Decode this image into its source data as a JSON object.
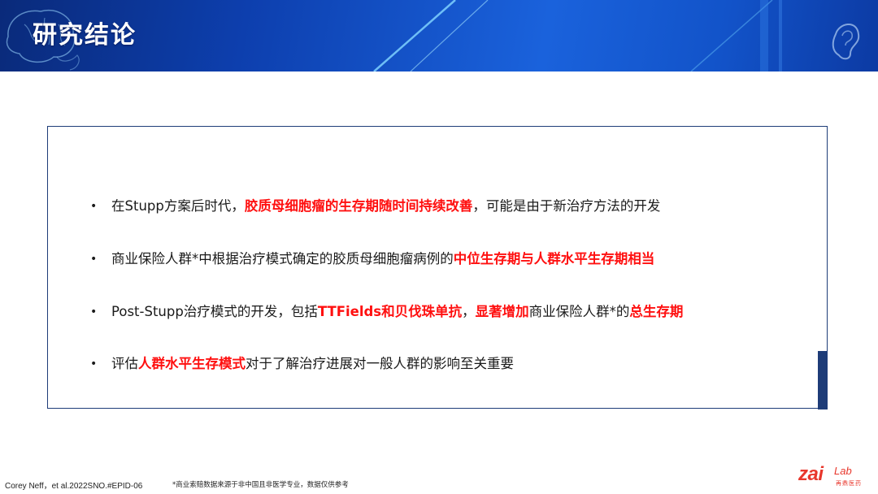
{
  "header": {
    "title": "研究结论"
  },
  "bullets": [
    {
      "segments": [
        {
          "text": "在Stupp方案后时代，",
          "hl": false
        },
        {
          "text": "胶质母细胞瘤的生存期随时间持续改善",
          "hl": true
        },
        {
          "text": "，可能是由于新治疗方法的开发",
          "hl": false
        }
      ]
    },
    {
      "segments": [
        {
          "text": "商业保险人群*中根据治疗模式确定的胶质母细胞瘤病例的",
          "hl": false
        },
        {
          "text": "中位生存期与人群水平生存期相当",
          "hl": true
        }
      ]
    },
    {
      "segments": [
        {
          "text": "Post-Stupp治疗模式的开发，包括",
          "hl": false
        },
        {
          "text": "TTFields和贝伐珠单抗",
          "hl": true
        },
        {
          "text": "，",
          "hl": false
        },
        {
          "text": "显著增加",
          "hl": true
        },
        {
          "text": "商业保险人群*的",
          "hl": false
        },
        {
          "text": "总生存期",
          "hl": true
        }
      ]
    },
    {
      "segments": [
        {
          "text": "评估",
          "hl": false
        },
        {
          "text": "人群水平生存模式",
          "hl": true
        },
        {
          "text": "对于了解治疗进展对一般人群的影响至关重要",
          "hl": false
        }
      ]
    }
  ],
  "footer": {
    "citation": "Corey Neff，et al.2022SNO.#EPID-06",
    "note": "*商业索赔数据来源于非中国且非医学专业，数据仅供参考"
  },
  "logo": {
    "main": "zai",
    "sub": "Lab",
    "cn": "再鼎医药"
  },
  "colors": {
    "banner": "#1253c9",
    "highlight": "#ff1010",
    "box_border": "#1e3c78",
    "logo": "#e8372c"
  }
}
